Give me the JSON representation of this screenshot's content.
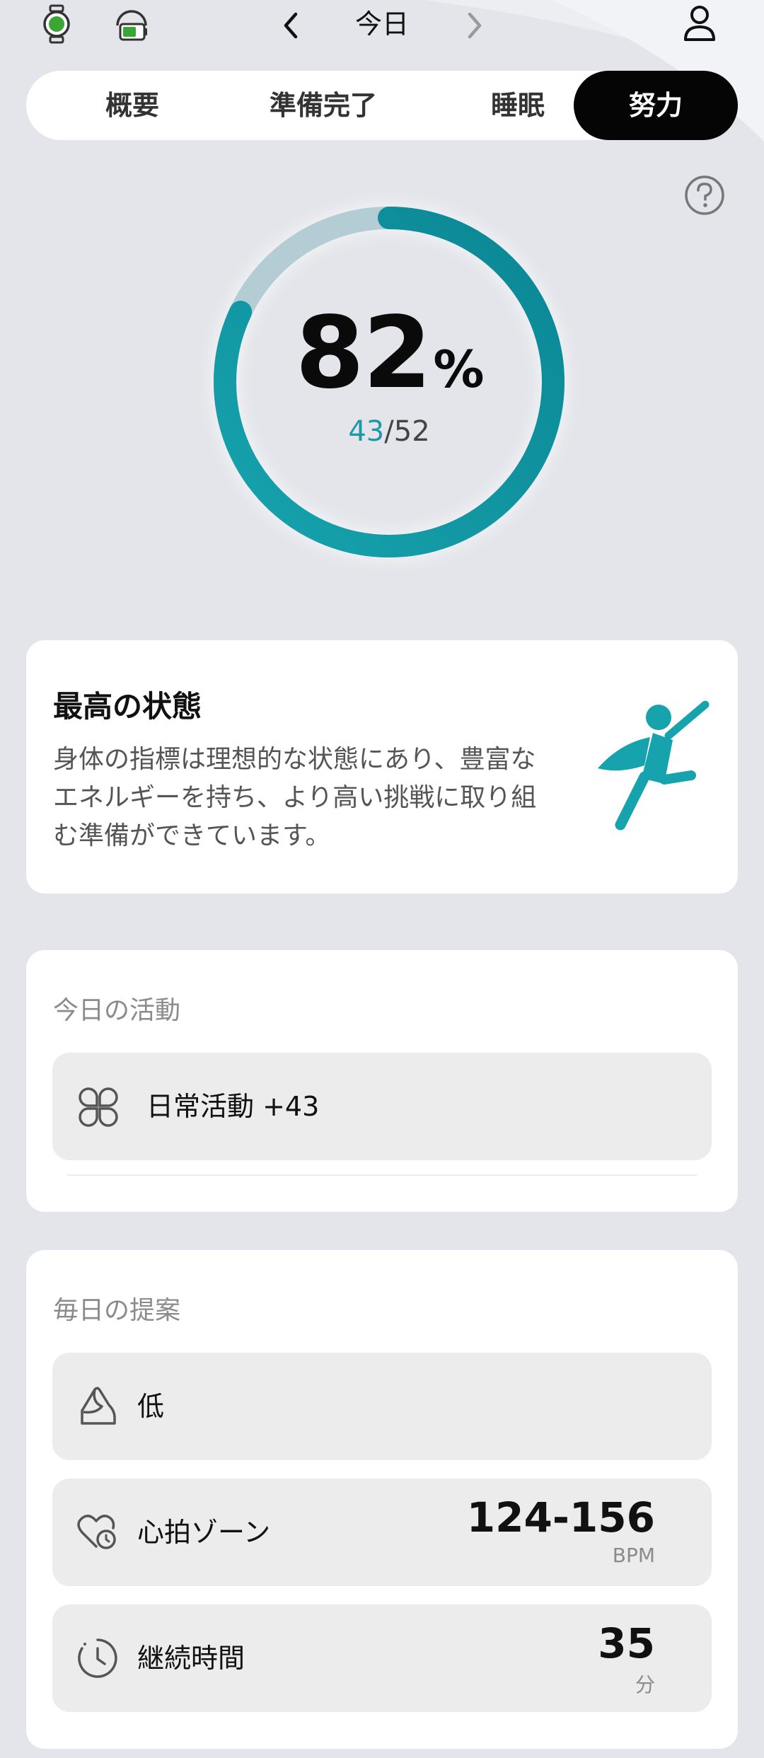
{
  "header": {
    "title": "今日"
  },
  "tabs": [
    {
      "label": "概要"
    },
    {
      "label": "準備完了"
    },
    {
      "label": "睡眠"
    },
    {
      "label": "努力",
      "active": true
    }
  ],
  "score": {
    "percent": "82",
    "percent_unit": "%",
    "current": "43",
    "total": "/52",
    "fraction": 0.82
  },
  "status": {
    "title": "最高の状態",
    "description": "身体の指標は理想的な状態にあり、豊富なエネルギーを持ち、より高い挑戦に取り組む準備ができています。"
  },
  "activity": {
    "label": "今日の活動",
    "items": [
      {
        "label": "日常活動 +43",
        "icon": "clover-icon"
      }
    ]
  },
  "suggestion": {
    "label": "毎日の提案",
    "items": [
      {
        "label": "低",
        "icon": "intensity-icon"
      },
      {
        "label": "心拍ゾーン",
        "value": "124-156",
        "unit": "BPM",
        "icon": "heart-icon"
      },
      {
        "label": "継続時間",
        "value": "35",
        "unit": "分",
        "icon": "clock-icon"
      }
    ]
  },
  "colors": {
    "accent": "#1a9aa8",
    "ring_track": "#b4cdd4",
    "active_tab": "#050505"
  }
}
